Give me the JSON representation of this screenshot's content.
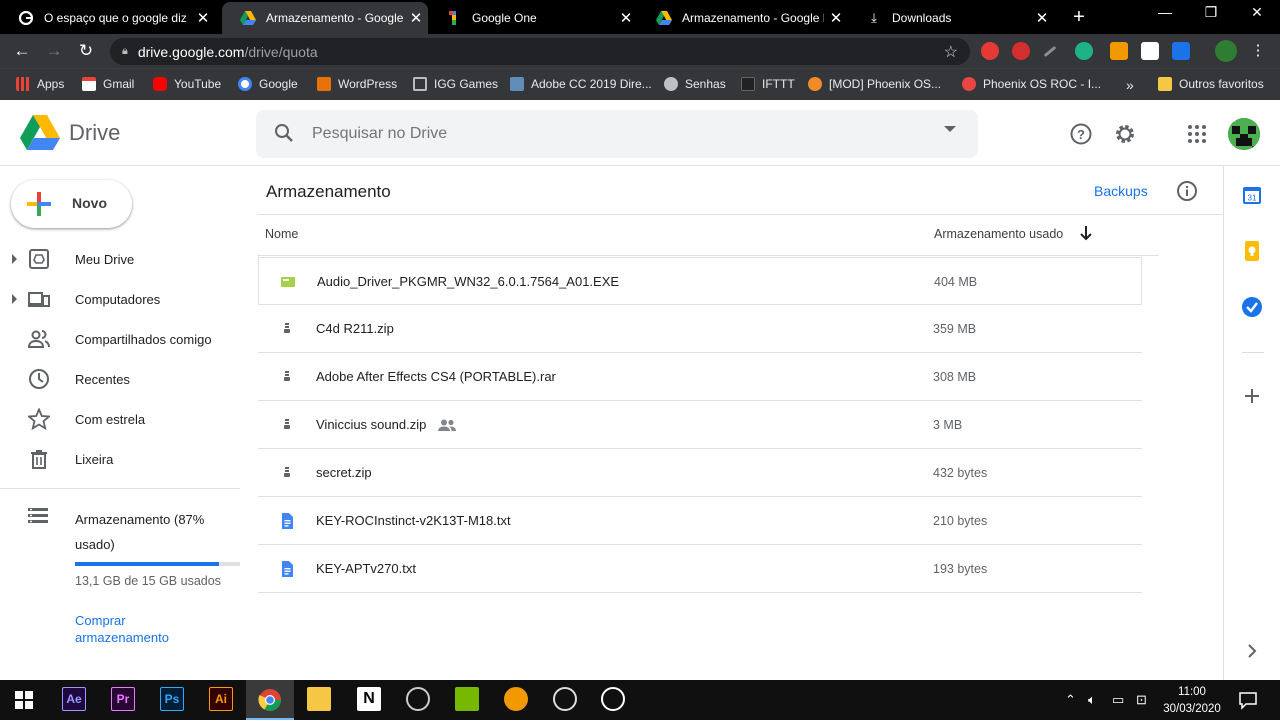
{
  "browser": {
    "tabs": [
      {
        "title": "O espaço que o google diz",
        "icon": "google-icon"
      },
      {
        "title": "Armazenamento - Google D",
        "icon": "drive-icon",
        "active": true
      },
      {
        "title": "Google One",
        "icon": "google-one-icon"
      },
      {
        "title": "Armazenamento - Google D",
        "icon": "drive-icon"
      },
      {
        "title": "Downloads",
        "icon": "download-icon"
      }
    ],
    "url_host": "drive.google.com",
    "url_path": "/drive/quota",
    "bookmarks": [
      {
        "label": "Apps",
        "color": "#ea4335"
      },
      {
        "label": "Gmail",
        "color": "#ea4335"
      },
      {
        "label": "YouTube",
        "color": "#ff0000"
      },
      {
        "label": "Google",
        "color": "#4285f4"
      },
      {
        "label": "WordPress",
        "color": "#e8710a"
      },
      {
        "label": "IGG Games",
        "color": "#9aa0a6"
      },
      {
        "label": "Adobe CC 2019 Dire...",
        "color": "#5f8db8"
      },
      {
        "label": "Senhas",
        "color": "#bdc1c6"
      },
      {
        "label": "IFTTT",
        "color": "#000000"
      },
      {
        "label": "[MOD] Phoenix OS...",
        "color": "#f28b29"
      },
      {
        "label": "Phoenix OS ROC - I...",
        "color": "#e84545"
      }
    ],
    "bookmarks_more": "»",
    "other_bookmarks": "Outros favoritos"
  },
  "drive": {
    "product": "Drive",
    "search_placeholder": "Pesquisar no Drive",
    "new_label": "Novo",
    "nav": [
      {
        "label": "Meu Drive",
        "icon": "my-drive-icon",
        "expandable": true
      },
      {
        "label": "Computadores",
        "icon": "computers-icon",
        "expandable": true
      },
      {
        "label": "Compartilhados comigo",
        "icon": "shared-with-me-icon"
      },
      {
        "label": "Recentes",
        "icon": "recent-icon"
      },
      {
        "label": "Com estrela",
        "icon": "starred-icon"
      },
      {
        "label": "Lixeira",
        "icon": "trash-icon"
      }
    ],
    "storage": {
      "label": "Armazenamento (87% usado)",
      "percent": 87,
      "used_text": "13,1 GB de 15 GB usados",
      "buy_label": "Comprar armazenamento"
    },
    "page_title": "Armazenamento",
    "backups_label": "Backups",
    "columns": {
      "name": "Nome",
      "size": "Armazenamento usado"
    },
    "files": [
      {
        "name": "Audio_Driver_PKGMR_WN32_6.0.1.7564_A01.EXE",
        "size": "404 MB",
        "icon": "exe-file-icon"
      },
      {
        "name": "C4d R211.zip",
        "size": "359 MB",
        "icon": "zip-file-icon"
      },
      {
        "name": "Adobe After Effects CS4 (PORTABLE).rar",
        "size": "308 MB",
        "icon": "zip-file-icon"
      },
      {
        "name": "Viniccius sound.zip",
        "size": "3 MB",
        "icon": "zip-file-icon",
        "shared": true
      },
      {
        "name": "secret.zip",
        "size": "432 bytes",
        "icon": "zip-file-icon"
      },
      {
        "name": "KEY-ROCInstinct-v2K13T-M18.txt",
        "size": "210 bytes",
        "icon": "text-file-icon"
      },
      {
        "name": "KEY-APTv270.txt",
        "size": "193 bytes",
        "icon": "text-file-icon"
      }
    ]
  },
  "taskbar": {
    "apps": [
      {
        "label": "Ae",
        "color": "#9999ff",
        "bg": "#1f0740"
      },
      {
        "label": "Pr",
        "color": "#e77bff",
        "bg": "#2a0634"
      },
      {
        "label": "Ps",
        "color": "#31a8ff",
        "bg": "#001e36"
      },
      {
        "label": "Ai",
        "color": "#ff9a00",
        "bg": "#330000"
      }
    ],
    "time": "11:00",
    "date": "30/03/2020"
  },
  "colors": {
    "accent": "#1a73e8",
    "text": "#202124",
    "muted": "#5f6368"
  }
}
